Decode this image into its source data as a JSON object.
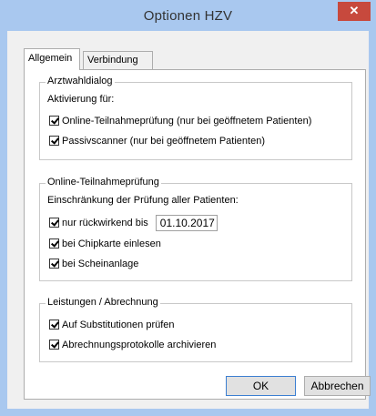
{
  "window": {
    "title": "Optionen HZV",
    "close_label": "✕"
  },
  "tabs": [
    {
      "label": "Allgemein",
      "selected": true
    },
    {
      "label": "Verbindung",
      "selected": false
    }
  ],
  "groups": {
    "arztwahl": {
      "title": "Arztwahldialog",
      "subtitle": "Aktivierung für:",
      "options": [
        {
          "label": "Online-Teilnahmeprüfung (nur bei geöffnetem Patienten)",
          "checked": true
        },
        {
          "label": "Passivscanner (nur bei geöffnetem Patienten)",
          "checked": true
        }
      ]
    },
    "online": {
      "title": "Online-Teilnahmeprüfung",
      "subtitle": "Einschränkung der Prüfung aller Patienten:",
      "date_option": {
        "label": "nur rückwirkend bis",
        "checked": true,
        "value": "01.10.2017"
      },
      "options": [
        {
          "label": "bei Chipkarte einlesen",
          "checked": true
        },
        {
          "label": "bei Scheinanlage",
          "checked": true
        }
      ]
    },
    "leistungen": {
      "title": "Leistungen / Abrechnung",
      "options": [
        {
          "label": "Auf Substitutionen prüfen",
          "checked": true
        },
        {
          "label": "Abrechnungsprotokolle archivieren",
          "checked": true
        }
      ]
    }
  },
  "buttons": {
    "ok": "OK",
    "cancel": "Abbrechen"
  },
  "colors": {
    "titlebar": "#a9c8ef",
    "close": "#c7493d",
    "dialog": "#f0f0f0"
  }
}
